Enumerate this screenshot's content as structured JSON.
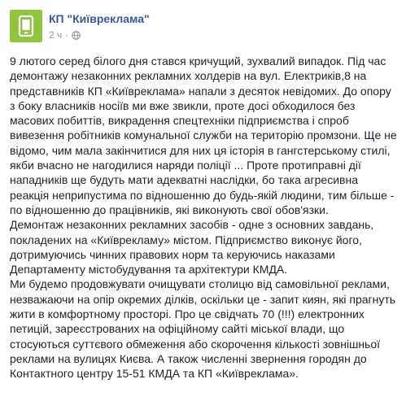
{
  "post": {
    "author": "КП \"Київреклама\"",
    "time": "2 ч",
    "separator": "·",
    "privacy_icon": "globe-icon",
    "avatar_icon": "phone-logo-icon",
    "paragraphs": [
      "9 лютого серед білого дня стався кричущий, зухвалий випадок. Під час демонтажу незаконних рекламних холдерів на вул. Електриків,8 на представників КП «Київреклама» напали з десяток невідомих. До опору з боку власників носіїв ми вже звикли, проте досі обходилося без масових побиттів, викрадення спецтехніки підприємства і спроб вивезення робітників комунальної служби на територію промзони. Ще не відомо, чим мала закінчитися для них ця історія в гангстерському стилі, якби вчасно не нагодилися наряди поліції ... Проте протиправні дії нападників ще будуть мати адекватні наслідки, бо така агресивна реакція неприпустима по відношенню до будь-якій людини, тим більше - по відношенню до працівників, які виконують свої обов'язки.",
      "Демонтаж незаконних рекламних засобів - одне з основних завдань, покладених на «Київрекламу» містом. Підприємство виконує його, дотримуючись чинних правових норм та керуючись наказами Департаменту містобудування та архітектури КМДА.",
      "Ми будемо продовжувати очищувати столицю від самовільної реклами, незважаючи на опір окремих ділків, оскільки це - запит киян, які прагнуть жити в комфортному просторі. Про це свідчать 70 (!!!) електронних петицій, зареєстрованих на офіційному сайті міської влади, що стосуються суттєвого обмеження або скорочення кількості зовнішньої реклами на вулицях Києва. А також численні звернення городян до Контактного центру 15-51 КМДА та КП «Київреклама»."
    ]
  },
  "colors": {
    "author_link": "#3b5998",
    "avatar_bg": "#8fc43c",
    "meta_text": "#90949c",
    "body_text": "#1d2129"
  }
}
